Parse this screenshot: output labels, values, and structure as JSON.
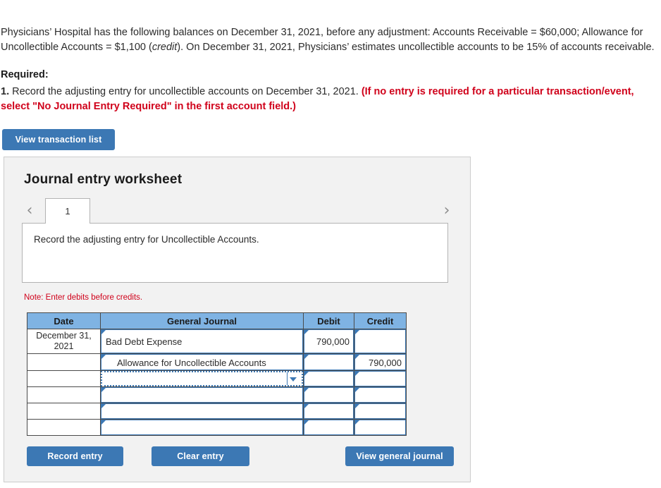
{
  "problem": {
    "segment1": "Physicians’ Hospital has the following balances on December 31, 2021, before any adjustment: Accounts Receivable = $60,000; Allowance for Uncollectible Accounts = $1,100 (",
    "italic": "credit",
    "segment2": "). On December 31, 2021, Physicians’ estimates uncollectible accounts to be 15% of accounts receivable."
  },
  "required": {
    "title": "Required:",
    "number": "1.",
    "text": " Record the adjusting entry for uncollectible accounts on December 31, 2021. ",
    "red_note": "(If no entry is required for a particular transaction/event, select \"No Journal Entry Required\" in the first account field.)"
  },
  "toolbar": {
    "view_transaction_list": "View transaction list"
  },
  "worksheet": {
    "title": "Journal entry worksheet",
    "prev_arrow": "‹",
    "next_arrow": "›",
    "tabs": [
      {
        "label": "1",
        "active": true
      }
    ],
    "instruction": "Record the adjusting entry for Uncollectible Accounts.",
    "note": "Note: Enter debits before credits."
  },
  "table": {
    "headers": [
      "Date",
      "General Journal",
      "Debit",
      "Credit"
    ],
    "rows": [
      {
        "date": "December 31, 2021",
        "account": "Bad Debt Expense",
        "indent": false,
        "debit": "790,000",
        "credit": "",
        "dropdown": false,
        "focused": false
      },
      {
        "date": "",
        "account": "Allowance for Uncollectible Accounts",
        "indent": true,
        "debit": "",
        "credit": "790,000",
        "dropdown": false,
        "focused": false
      },
      {
        "date": "",
        "account": "",
        "indent": false,
        "debit": "",
        "credit": "",
        "dropdown": true,
        "focused": true
      },
      {
        "date": "",
        "account": "",
        "indent": false,
        "debit": "",
        "credit": "",
        "dropdown": false,
        "focused": false
      },
      {
        "date": "",
        "account": "",
        "indent": false,
        "debit": "",
        "credit": "",
        "dropdown": false,
        "focused": false
      },
      {
        "date": "",
        "account": "",
        "indent": false,
        "debit": "",
        "credit": "",
        "dropdown": false,
        "focused": false
      }
    ]
  },
  "footer": {
    "record_entry": "Record entry",
    "clear_entry": "Clear entry",
    "view_general_journal": "View general journal"
  },
  "colors": {
    "accent_blue": "#3c78b4",
    "header_blue": "#7fb3e3",
    "alert_red": "#d0021b",
    "panel_gray": "#f2f2f2"
  }
}
